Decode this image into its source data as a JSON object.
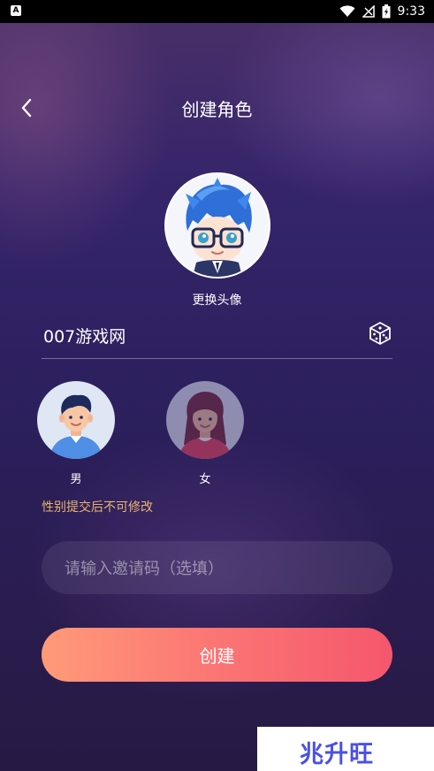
{
  "status_bar": {
    "left_icon_letter": "A",
    "time": "9:33",
    "icons": [
      "wifi-icon",
      "signal-icon",
      "battery-icon"
    ]
  },
  "header": {
    "title": "创建角色",
    "back_icon": "chevron-left-icon"
  },
  "avatar": {
    "change_label": "更换头像"
  },
  "name_field": {
    "value": "007游戏网",
    "dice_icon": "dice-icon"
  },
  "gender": {
    "options": [
      {
        "label": "男",
        "selected": true
      },
      {
        "label": "女",
        "selected": false
      }
    ],
    "note": "性别提交后不可修改"
  },
  "invite": {
    "placeholder": "请输入邀请码（选填）"
  },
  "submit": {
    "label": "创建"
  },
  "watermark": {
    "text": "兆升旺"
  },
  "colors": {
    "note": "#e9b36d",
    "button_start": "#ff9a78",
    "button_end": "#f5576c",
    "watermark": "#4a50e6"
  }
}
